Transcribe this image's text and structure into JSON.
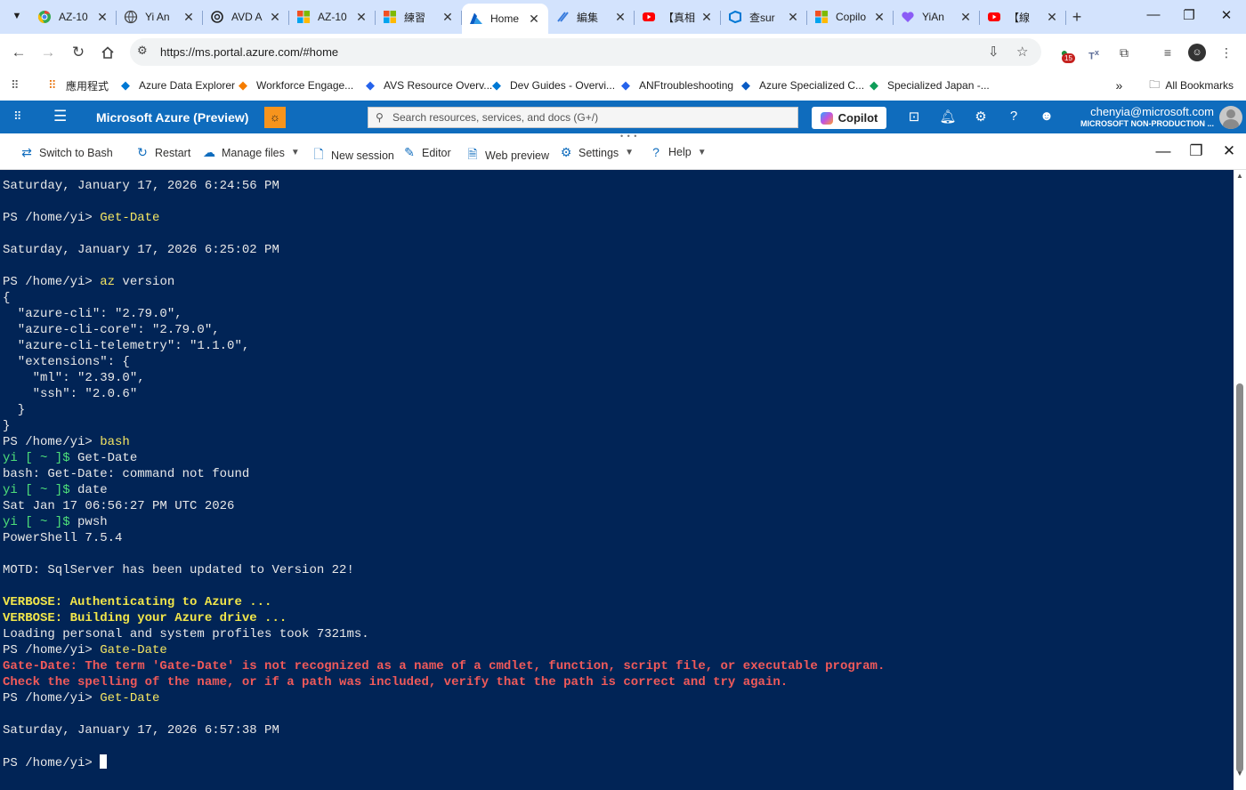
{
  "browser": {
    "tabs": [
      {
        "title": "AZ-10",
        "icon": "chrome-color-icon",
        "active": false
      },
      {
        "title": "Yi An",
        "icon": "globe-icon",
        "active": false
      },
      {
        "title": "AVD A",
        "icon": "openai-icon",
        "active": false
      },
      {
        "title": "AZ-10",
        "icon": "microsoft-icon",
        "active": false
      },
      {
        "title": "練習",
        "icon": "microsoft-icon",
        "active": false
      },
      {
        "title": "Home",
        "icon": "azure-icon",
        "active": true
      },
      {
        "title": "編集",
        "icon": "edit-icon",
        "active": false
      },
      {
        "title": "【真相",
        "icon": "youtube-icon",
        "active": false
      },
      {
        "title": "查sur",
        "icon": "devops-icon",
        "active": false
      },
      {
        "title": "Copilo",
        "icon": "microsoft-icon",
        "active": false
      },
      {
        "title": "YiAn",
        "icon": "heart-icon",
        "active": false
      },
      {
        "title": "【線",
        "icon": "youtube-icon",
        "active": false
      }
    ],
    "url": "https://ms.portal.azure.com/#home",
    "extension_badge": "15",
    "bookmarks": [
      {
        "label": "",
        "icon": "apps-grid-icon"
      },
      {
        "label": "應用程式",
        "icon": "apps-icon"
      },
      {
        "label": "Azure Data Explorer",
        "icon": "data-explorer-icon"
      },
      {
        "label": "Workforce Engage...",
        "icon": "workforce-icon"
      },
      {
        "label": "AVS Resource Overv...",
        "icon": "avs-icon"
      },
      {
        "label": "Dev Guides - Overvi...",
        "icon": "devops-icon"
      },
      {
        "label": "ANFtroubleshooting",
        "icon": "avs-icon"
      },
      {
        "label": "Azure Specialized C...",
        "icon": "azure-icon"
      },
      {
        "label": "Specialized Japan -...",
        "icon": "cloud-icon"
      }
    ],
    "all_bookmarks_label": "All Bookmarks"
  },
  "azure": {
    "title": "Microsoft Azure (Preview)",
    "search_placeholder": "Search resources, services, and docs (G+/)",
    "copilot_label": "Copilot",
    "user_email": "chenyia@microsoft.com",
    "user_tenant": "MICROSOFT NON-PRODUCTION ..."
  },
  "shell_toolbar": {
    "switch_label": "Switch to Bash",
    "restart_label": "Restart",
    "manage_files_label": "Manage files",
    "new_session_label": "New session",
    "editor_label": "Editor",
    "web_preview_label": "Web preview",
    "settings_label": "Settings",
    "help_label": "Help"
  },
  "terminal": {
    "lines": [
      {
        "parts": [
          {
            "t": "Saturday, January 17, 2026 6:24:56 PM",
            "c": "out"
          }
        ]
      },
      {
        "parts": []
      },
      {
        "parts": [
          {
            "t": "PS /home/yi> ",
            "c": "out"
          },
          {
            "t": "Get-Date",
            "c": "cmd"
          }
        ]
      },
      {
        "parts": []
      },
      {
        "parts": [
          {
            "t": "Saturday, January 17, 2026 6:25:02 PM",
            "c": "out"
          }
        ]
      },
      {
        "parts": []
      },
      {
        "parts": [
          {
            "t": "PS /home/yi> ",
            "c": "out"
          },
          {
            "t": "az",
            "c": "cmd"
          },
          {
            "t": " version",
            "c": "out"
          }
        ]
      },
      {
        "parts": [
          {
            "t": "{",
            "c": "out"
          }
        ]
      },
      {
        "parts": [
          {
            "t": "  \"azure-cli\": \"2.79.0\",",
            "c": "out"
          }
        ]
      },
      {
        "parts": [
          {
            "t": "  \"azure-cli-core\": \"2.79.0\",",
            "c": "out"
          }
        ]
      },
      {
        "parts": [
          {
            "t": "  \"azure-cli-telemetry\": \"1.1.0\",",
            "c": "out"
          }
        ]
      },
      {
        "parts": [
          {
            "t": "  \"extensions\": {",
            "c": "out"
          }
        ]
      },
      {
        "parts": [
          {
            "t": "    \"ml\": \"2.39.0\",",
            "c": "out"
          }
        ]
      },
      {
        "parts": [
          {
            "t": "    \"ssh\": \"2.0.6\"",
            "c": "out"
          }
        ]
      },
      {
        "parts": [
          {
            "t": "  }",
            "c": "out"
          }
        ]
      },
      {
        "parts": [
          {
            "t": "}",
            "c": "out"
          }
        ]
      },
      {
        "parts": [
          {
            "t": "PS /home/yi> ",
            "c": "out"
          },
          {
            "t": "bash",
            "c": "cmd"
          }
        ]
      },
      {
        "parts": [
          {
            "t": "yi [ ~ ]$",
            "c": "gr"
          },
          {
            "t": " Get-Date",
            "c": "out"
          }
        ]
      },
      {
        "parts": [
          {
            "t": "bash: Get-Date: command not found",
            "c": "out"
          }
        ]
      },
      {
        "parts": [
          {
            "t": "yi [ ~ ]$",
            "c": "gr"
          },
          {
            "t": " date",
            "c": "out"
          }
        ]
      },
      {
        "parts": [
          {
            "t": "Sat Jan 17 06:56:27 PM UTC 2026",
            "c": "out"
          }
        ]
      },
      {
        "parts": [
          {
            "t": "yi [ ~ ]$",
            "c": "gr"
          },
          {
            "t": " pwsh",
            "c": "out"
          }
        ]
      },
      {
        "parts": [
          {
            "t": "PowerShell 7.5.4",
            "c": "out"
          }
        ]
      },
      {
        "parts": []
      },
      {
        "parts": [
          {
            "t": "MOTD: SqlServer has been updated to Version 22!",
            "c": "out"
          }
        ]
      },
      {
        "parts": []
      },
      {
        "parts": [
          {
            "t": "VERBOSE: Authenticating to Azure ...",
            "c": "warn"
          }
        ]
      },
      {
        "parts": [
          {
            "t": "VERBOSE: Building your Azure drive ...",
            "c": "warn"
          }
        ]
      },
      {
        "parts": [
          {
            "t": "Loading personal and system profiles took 7321ms.",
            "c": "out"
          }
        ]
      },
      {
        "parts": [
          {
            "t": "PS /home/yi> ",
            "c": "out"
          },
          {
            "t": "Gate-Date",
            "c": "cmd"
          }
        ]
      },
      {
        "parts": [
          {
            "t": "Gate-Date: The term 'Gate-Date' is not recognized as a name of a cmdlet, function, script file, or executable program.",
            "c": "err"
          }
        ]
      },
      {
        "parts": [
          {
            "t": "Check the spelling of the name, or if a path was included, verify that the path is correct and try again.",
            "c": "err"
          }
        ]
      },
      {
        "parts": [
          {
            "t": "PS /home/yi> ",
            "c": "out"
          },
          {
            "t": "Get-Date",
            "c": "cmd"
          }
        ]
      },
      {
        "parts": []
      },
      {
        "parts": [
          {
            "t": "Saturday, January 17, 2026 6:57:38 PM",
            "c": "out"
          }
        ]
      },
      {
        "parts": []
      },
      {
        "parts": [
          {
            "t": "PS /home/yi> ",
            "c": "out"
          }
        ],
        "cursor": true
      }
    ]
  },
  "colors": {
    "terminal_bg": "#012456",
    "azure_header": "#0f6cbd",
    "command": "#f5e663",
    "prompt_bash": "#4ee07a",
    "verbose": "#f2e64a",
    "error": "#f05a5a"
  }
}
